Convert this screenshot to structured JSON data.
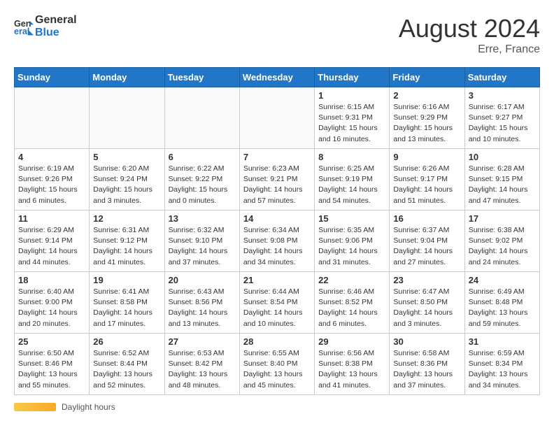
{
  "header": {
    "logo_text_general": "General",
    "logo_text_blue": "Blue",
    "month_year": "August 2024",
    "location": "Erre, France"
  },
  "days_of_week": [
    "Sunday",
    "Monday",
    "Tuesday",
    "Wednesday",
    "Thursday",
    "Friday",
    "Saturday"
  ],
  "weeks": [
    [
      {
        "day": "",
        "info": ""
      },
      {
        "day": "",
        "info": ""
      },
      {
        "day": "",
        "info": ""
      },
      {
        "day": "",
        "info": ""
      },
      {
        "day": "1",
        "info": "Sunrise: 6:15 AM\nSunset: 9:31 PM\nDaylight: 15 hours\nand 16 minutes."
      },
      {
        "day": "2",
        "info": "Sunrise: 6:16 AM\nSunset: 9:29 PM\nDaylight: 15 hours\nand 13 minutes."
      },
      {
        "day": "3",
        "info": "Sunrise: 6:17 AM\nSunset: 9:27 PM\nDaylight: 15 hours\nand 10 minutes."
      }
    ],
    [
      {
        "day": "4",
        "info": "Sunrise: 6:19 AM\nSunset: 9:26 PM\nDaylight: 15 hours\nand 6 minutes."
      },
      {
        "day": "5",
        "info": "Sunrise: 6:20 AM\nSunset: 9:24 PM\nDaylight: 15 hours\nand 3 minutes."
      },
      {
        "day": "6",
        "info": "Sunrise: 6:22 AM\nSunset: 9:22 PM\nDaylight: 15 hours\nand 0 minutes."
      },
      {
        "day": "7",
        "info": "Sunrise: 6:23 AM\nSunset: 9:21 PM\nDaylight: 14 hours\nand 57 minutes."
      },
      {
        "day": "8",
        "info": "Sunrise: 6:25 AM\nSunset: 9:19 PM\nDaylight: 14 hours\nand 54 minutes."
      },
      {
        "day": "9",
        "info": "Sunrise: 6:26 AM\nSunset: 9:17 PM\nDaylight: 14 hours\nand 51 minutes."
      },
      {
        "day": "10",
        "info": "Sunrise: 6:28 AM\nSunset: 9:15 PM\nDaylight: 14 hours\nand 47 minutes."
      }
    ],
    [
      {
        "day": "11",
        "info": "Sunrise: 6:29 AM\nSunset: 9:14 PM\nDaylight: 14 hours\nand 44 minutes."
      },
      {
        "day": "12",
        "info": "Sunrise: 6:31 AM\nSunset: 9:12 PM\nDaylight: 14 hours\nand 41 minutes."
      },
      {
        "day": "13",
        "info": "Sunrise: 6:32 AM\nSunset: 9:10 PM\nDaylight: 14 hours\nand 37 minutes."
      },
      {
        "day": "14",
        "info": "Sunrise: 6:34 AM\nSunset: 9:08 PM\nDaylight: 14 hours\nand 34 minutes."
      },
      {
        "day": "15",
        "info": "Sunrise: 6:35 AM\nSunset: 9:06 PM\nDaylight: 14 hours\nand 31 minutes."
      },
      {
        "day": "16",
        "info": "Sunrise: 6:37 AM\nSunset: 9:04 PM\nDaylight: 14 hours\nand 27 minutes."
      },
      {
        "day": "17",
        "info": "Sunrise: 6:38 AM\nSunset: 9:02 PM\nDaylight: 14 hours\nand 24 minutes."
      }
    ],
    [
      {
        "day": "18",
        "info": "Sunrise: 6:40 AM\nSunset: 9:00 PM\nDaylight: 14 hours\nand 20 minutes."
      },
      {
        "day": "19",
        "info": "Sunrise: 6:41 AM\nSunset: 8:58 PM\nDaylight: 14 hours\nand 17 minutes."
      },
      {
        "day": "20",
        "info": "Sunrise: 6:43 AM\nSunset: 8:56 PM\nDaylight: 14 hours\nand 13 minutes."
      },
      {
        "day": "21",
        "info": "Sunrise: 6:44 AM\nSunset: 8:54 PM\nDaylight: 14 hours\nand 10 minutes."
      },
      {
        "day": "22",
        "info": "Sunrise: 6:46 AM\nSunset: 8:52 PM\nDaylight: 14 hours\nand 6 minutes."
      },
      {
        "day": "23",
        "info": "Sunrise: 6:47 AM\nSunset: 8:50 PM\nDaylight: 14 hours\nand 3 minutes."
      },
      {
        "day": "24",
        "info": "Sunrise: 6:49 AM\nSunset: 8:48 PM\nDaylight: 13 hours\nand 59 minutes."
      }
    ],
    [
      {
        "day": "25",
        "info": "Sunrise: 6:50 AM\nSunset: 8:46 PM\nDaylight: 13 hours\nand 55 minutes."
      },
      {
        "day": "26",
        "info": "Sunrise: 6:52 AM\nSunset: 8:44 PM\nDaylight: 13 hours\nand 52 minutes."
      },
      {
        "day": "27",
        "info": "Sunrise: 6:53 AM\nSunset: 8:42 PM\nDaylight: 13 hours\nand 48 minutes."
      },
      {
        "day": "28",
        "info": "Sunrise: 6:55 AM\nSunset: 8:40 PM\nDaylight: 13 hours\nand 45 minutes."
      },
      {
        "day": "29",
        "info": "Sunrise: 6:56 AM\nSunset: 8:38 PM\nDaylight: 13 hours\nand 41 minutes."
      },
      {
        "day": "30",
        "info": "Sunrise: 6:58 AM\nSunset: 8:36 PM\nDaylight: 13 hours\nand 37 minutes."
      },
      {
        "day": "31",
        "info": "Sunrise: 6:59 AM\nSunset: 8:34 PM\nDaylight: 13 hours\nand 34 minutes."
      }
    ]
  ],
  "footer": {
    "daylight_label": "Daylight hours"
  }
}
